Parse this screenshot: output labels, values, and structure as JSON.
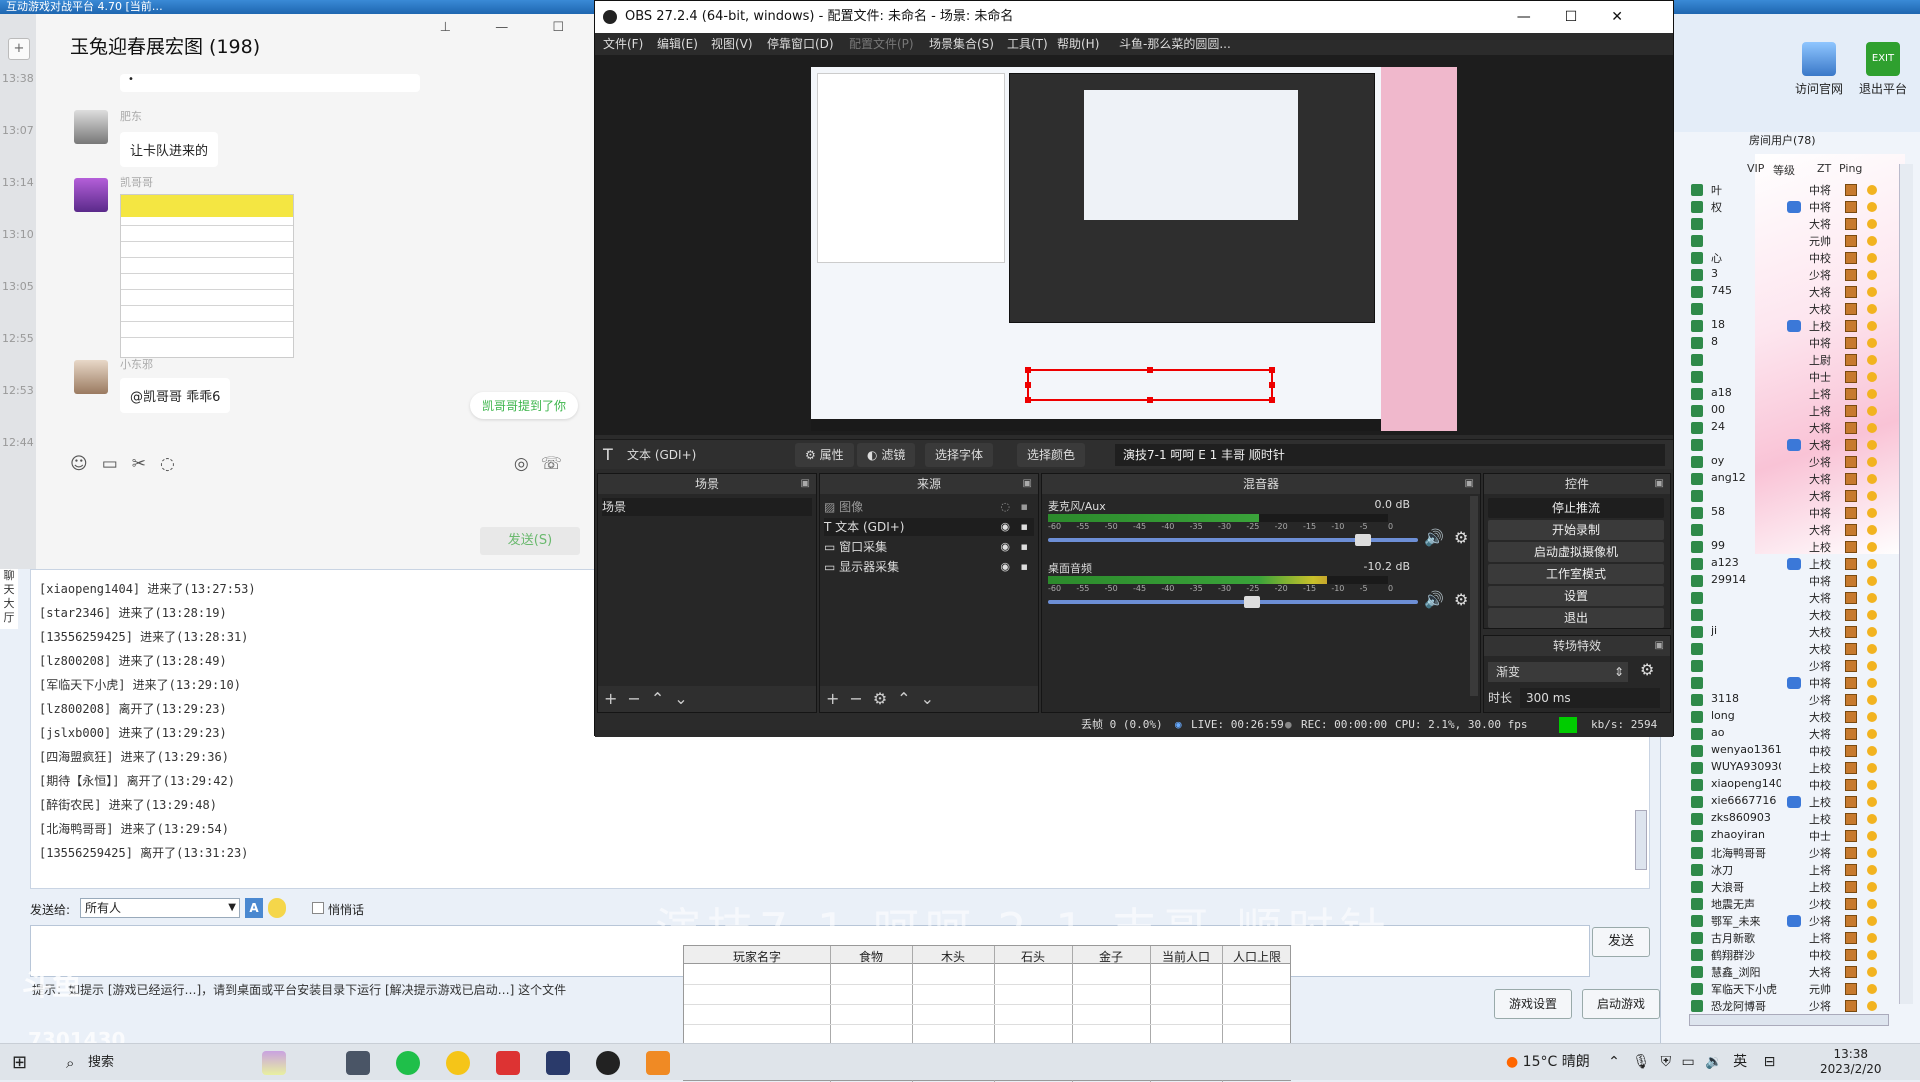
{
  "topbar": {
    "text": "互动游戏对战平台 4.70 [当前…"
  },
  "chat": {
    "title": "玉兔迎春展宏图 (198)",
    "times": [
      "13:38",
      "13:07",
      "13:14",
      "13:10",
      "13:05",
      "12:55",
      "12:53",
      "12:44"
    ],
    "messages": [
      {
        "name": "肥东",
        "text": "让卡队进来的"
      },
      {
        "name": "凯哥哥",
        "text": ""
      },
      {
        "name": "小东邪",
        "text": "@凯哥哥 乖乖6"
      }
    ],
    "pill": "凯哥哥提到了你",
    "send_label": "发送(S)"
  },
  "obs": {
    "title": "OBS 27.2.4 (64-bit, windows) - 配置文件: 未命名 - 场景: 未命名",
    "menu": [
      "文件(F)",
      "编辑(E)",
      "视图(V)",
      "停靠窗口(D)",
      "配置文件(P)",
      "场景集合(S)",
      "工具(T)",
      "帮助(H)",
      "斗鱼-那么菜的圆圆..."
    ],
    "source_bar": {
      "source": "文本 (GDI+)",
      "properties": "属性",
      "filters": "滤镜",
      "select_font": "选择字体",
      "select_color": "选择颜色",
      "text_value": "演技7-1 呵呵 E 1 丰哥 顺时针"
    },
    "docks": {
      "scenes": {
        "title": "场景",
        "items": [
          "场景"
        ]
      },
      "sources": {
        "title": "来源",
        "items": [
          "图像",
          "文本 (GDI+)",
          "窗口采集",
          "显示器采集"
        ]
      },
      "mixer": {
        "title": "混音器",
        "tracks": [
          {
            "name": "麦克风/Aux",
            "db": "0.0 dB",
            "level": 0.62,
            "volume": 0.85
          },
          {
            "name": "桌面音频",
            "db": "-10.2 dB",
            "level": 0.82,
            "volume": 0.55
          }
        ],
        "scale": [
          "-60",
          "-55",
          "-50",
          "-45",
          "-40",
          "-35",
          "-30",
          "-25",
          "-20",
          "-15",
          "-10",
          "-5",
          "0"
        ]
      },
      "controls": {
        "title": "控件",
        "buttons": [
          "停止推流",
          "开始录制",
          "启动虚拟摄像机",
          "工作室模式",
          "设置",
          "退出"
        ]
      },
      "transitions": {
        "title": "转场特效",
        "type": "渐变",
        "duration_label": "时长",
        "duration": "300 ms"
      }
    },
    "status": {
      "dropped": "丢帧 0 (0.0%)",
      "live": "LIVE: 00:26:59",
      "rec": "REC: 00:00:00",
      "cpu": "CPU: 2.1%, 30.00 fps",
      "kbps": "kb/s: 2594"
    }
  },
  "lobby": {
    "left_tab": "聊天大厅",
    "log": [
      "[xiaopeng1404] 进来了(13:27:53)",
      "[star2346] 进来了(13:28:19)",
      "[13556259425] 进来了(13:28:31)",
      "[lz800208] 进来了(13:28:49)",
      "[军临天下小虎] 进来了(13:29:10)",
      "[lz800208] 离开了(13:29:23)",
      "[jslxb000] 进来了(13:29:23)",
      "[四海盟疯狂] 进来了(13:29:36)",
      "[期待【永恒】] 离开了(13:29:42)",
      "[醉街农民] 进来了(13:29:48)",
      "[北海鸭哥哥] 进来了(13:29:54)",
      "[13556259425] 离开了(13:31:23)"
    ],
    "send_to_label": "发送给:",
    "send_to_value": "所有人",
    "whisper_label": "悄悄话",
    "send_button": "发送",
    "tip": "提示：如提示 [游戏已经运行…]，请到桌面或平台安装目录下运行 [解决提示游戏已启动…] 这个文件",
    "game_settings": "游戏设置",
    "start_game": "启动游戏",
    "overlay_text": "演技7-1 呵呵 2-1 丰哥 顺时针",
    "watermark": "7301430"
  },
  "game_table": {
    "headers": [
      "玩家名字",
      "食物",
      "木头",
      "石头",
      "金子",
      "当前人口",
      "人口上限"
    ]
  },
  "right": {
    "visit_site": "访问官网",
    "exit_platform": "退出平台",
    "room_users": "房间用户(78)",
    "columns": [
      "VIP",
      "等级",
      "ZT",
      "Ping"
    ],
    "users": [
      {
        "name": "叶",
        "rank": "中将"
      },
      {
        "name": "权",
        "rank": "中将"
      },
      {
        "name": "",
        "rank": "大将"
      },
      {
        "name": "",
        "rank": "元帅"
      },
      {
        "name": "心",
        "rank": "中校"
      },
      {
        "name": "3",
        "rank": "少将"
      },
      {
        "name": "745",
        "rank": "大将"
      },
      {
        "name": "",
        "rank": "大校"
      },
      {
        "name": "18",
        "rank": "上校"
      },
      {
        "name": "8",
        "rank": "中将"
      },
      {
        "name": "",
        "rank": "上尉"
      },
      {
        "name": "",
        "rank": "中士"
      },
      {
        "name": "a18",
        "rank": "上将"
      },
      {
        "name": "00",
        "rank": "上将"
      },
      {
        "name": "24",
        "rank": "大将"
      },
      {
        "name": "",
        "rank": "大将"
      },
      {
        "name": "oy",
        "rank": "少将"
      },
      {
        "name": "ang12",
        "rank": "大将"
      },
      {
        "name": "",
        "rank": "大将"
      },
      {
        "name": "58",
        "rank": "中将"
      },
      {
        "name": "",
        "rank": "大将"
      },
      {
        "name": "99",
        "rank": "上校"
      },
      {
        "name": "a123",
        "rank": "上校"
      },
      {
        "name": "29914",
        "rank": "中将"
      },
      {
        "name": "",
        "rank": "大将"
      },
      {
        "name": "",
        "rank": "大校"
      },
      {
        "name": "ji",
        "rank": "大校"
      },
      {
        "name": "",
        "rank": "大校"
      },
      {
        "name": "",
        "rank": "少将"
      },
      {
        "name": "",
        "rank": "中将"
      },
      {
        "name": "3118",
        "rank": "少将"
      },
      {
        "name": "long",
        "rank": "大校"
      },
      {
        "name": "ao",
        "rank": "大将"
      },
      {
        "name": "wenyao136136",
        "rank": "中校"
      },
      {
        "name": "WUYA9309300",
        "rank": "上校"
      },
      {
        "name": "xiaopeng1404",
        "rank": "中校"
      },
      {
        "name": "xie6667716",
        "rank": "上校"
      },
      {
        "name": "zks860903",
        "rank": "上校"
      },
      {
        "name": "zhaoyiran",
        "rank": "中士"
      },
      {
        "name": "北海鸭哥哥",
        "rank": "少将"
      },
      {
        "name": "冰刀",
        "rank": "上将"
      },
      {
        "name": "大浪哥",
        "rank": "上校"
      },
      {
        "name": "地震无声",
        "rank": "少校"
      },
      {
        "name": "鄂军_未来",
        "rank": "少将"
      },
      {
        "name": "古月新歌",
        "rank": "上将"
      },
      {
        "name": "鹤翔群沙",
        "rank": "中校"
      },
      {
        "name": "慧鑫_浏阳",
        "rank": "大将"
      },
      {
        "name": "军临天下小虎",
        "rank": "元帅"
      },
      {
        "name": "恐龙阿博哥",
        "rank": "少将"
      }
    ]
  },
  "taskbar": {
    "search": "搜索",
    "weather": "15°C 晴朗",
    "ime": "英",
    "time": "13:38",
    "date": "2023/2/20"
  }
}
